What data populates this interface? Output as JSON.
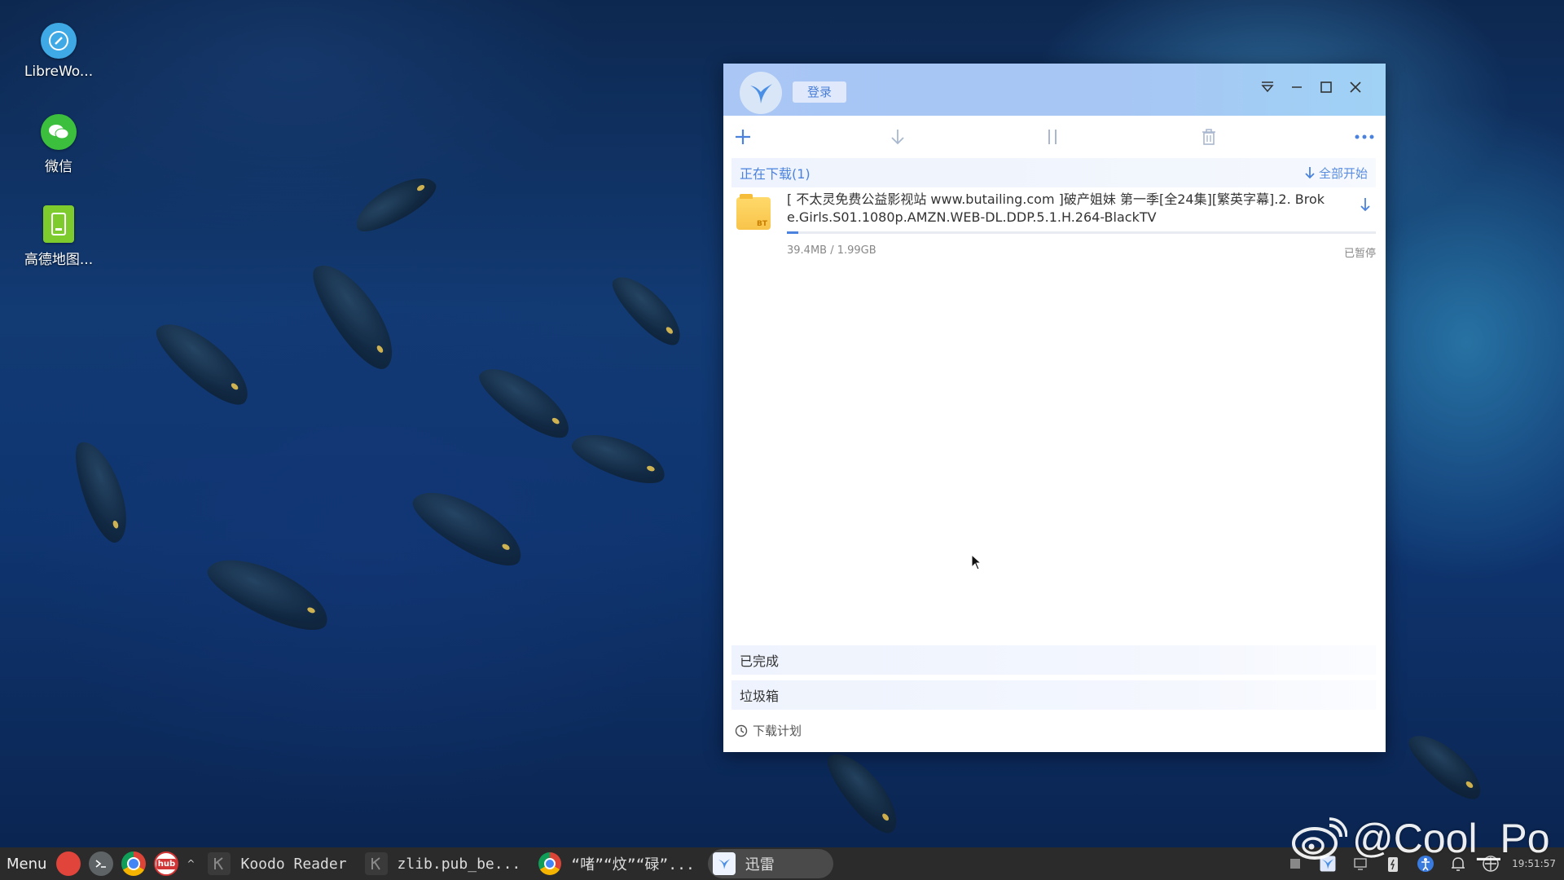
{
  "desktop": {
    "icons": [
      {
        "label": "LibreWo...",
        "icon": "libreoffice-writer-icon",
        "color": "#3fa9e6"
      },
      {
        "label": "微信",
        "icon": "wechat-icon",
        "color": "#3cbf3c"
      },
      {
        "label": "高德地图...",
        "icon": "amap-icon",
        "color": "#7ecb2e"
      }
    ]
  },
  "window": {
    "login_label": "登录",
    "section": {
      "title": "正在下载(1)",
      "start_all_label": "全部开始"
    },
    "task": {
      "name": "[ 不太灵免费公益影视站 www.butailing.com ]破产姐妹 第一季[全24集][繁英字幕].2. Broke.Girls.S01.1080p.AMZN.WEB-DL.DDP.5.1.H.264-BlackTV",
      "file_badge": "BT",
      "size": "39.4MB / 1.99GB",
      "progress": 0.02,
      "status": "已暂停"
    },
    "groups": {
      "completed": "已完成",
      "trash": "垃圾箱"
    },
    "schedule_label": "下载计划",
    "accent": "#4a82de"
  },
  "taskbar": {
    "menu_label": "Menu",
    "launchers": [
      {
        "icon": "red-app-icon",
        "color": "#e0443a"
      },
      {
        "icon": "terminal-icon",
        "color": "#5e6366"
      },
      {
        "icon": "chrome-icon",
        "color": "#e8b52b"
      },
      {
        "icon": "hub-icon",
        "color": "#d23535",
        "text": "hub"
      }
    ],
    "tasks": [
      {
        "label": "Koodo Reader"
      },
      {
        "label": "zlib.pub_be..."
      },
      {
        "label": "“啫”“炆”“碌”..."
      },
      {
        "label": "迅雷"
      }
    ],
    "clock": "19:51:57"
  },
  "watermark": {
    "text": "@Cool_Po"
  }
}
